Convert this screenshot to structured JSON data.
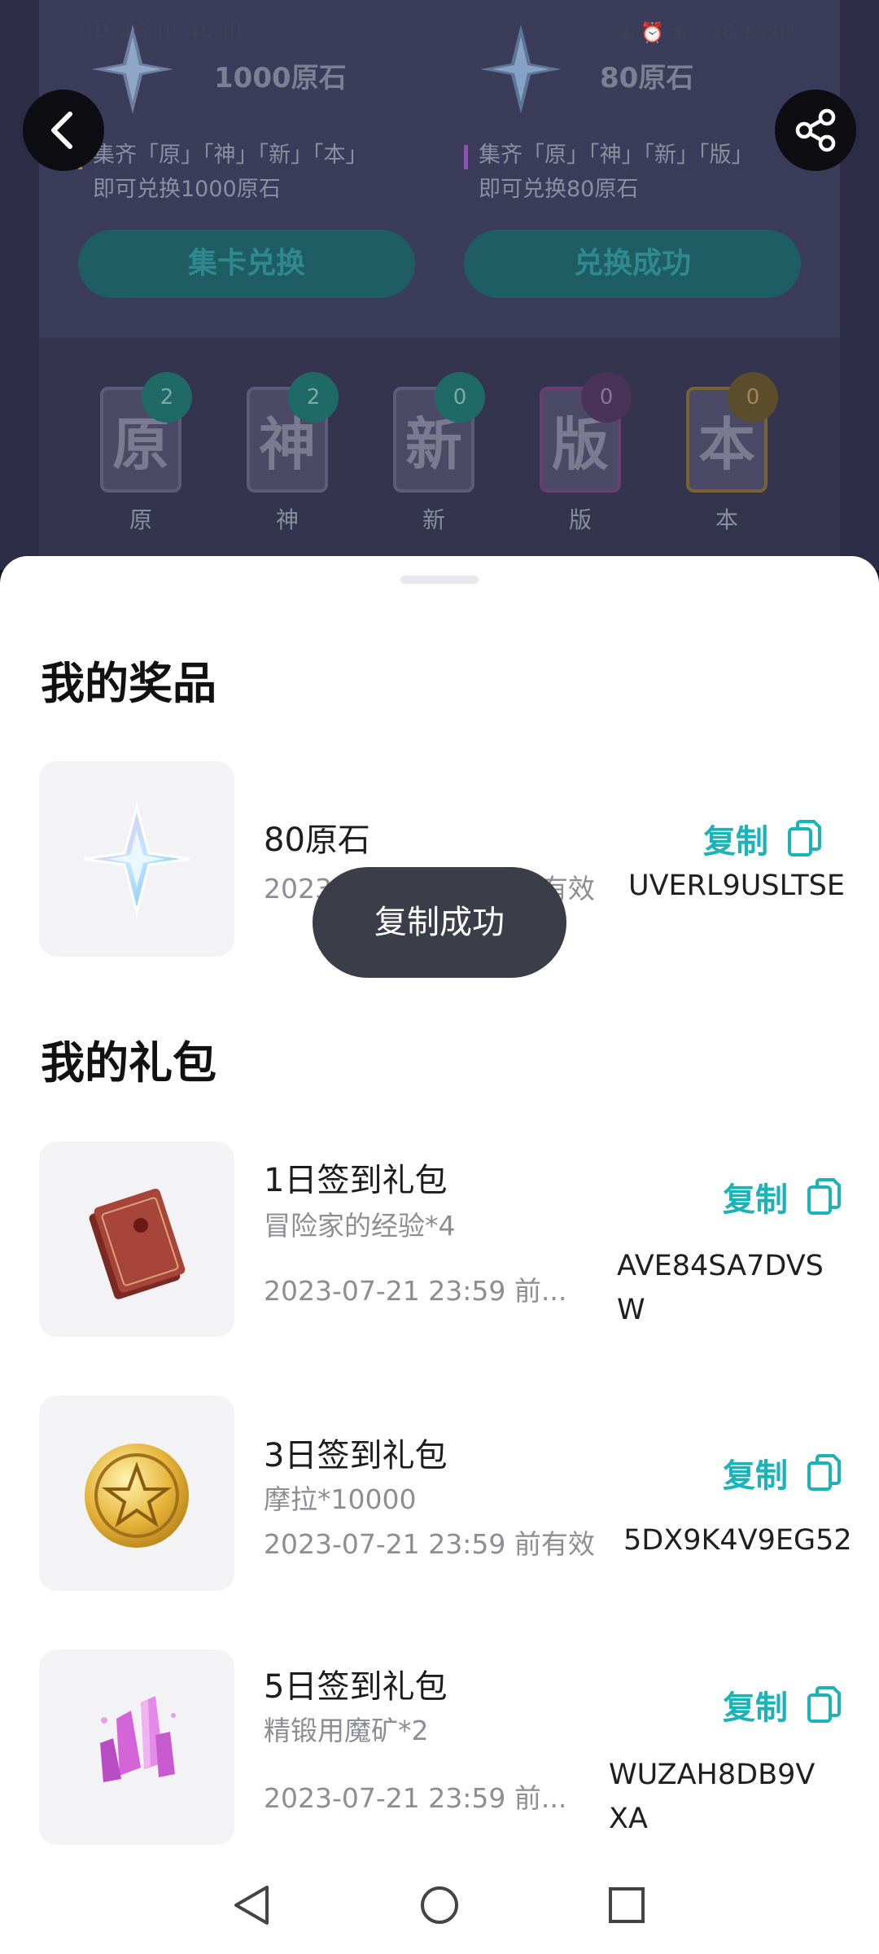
{
  "status_bar": {
    "left": "HD 4G ıll 46 ıll",
    "right": "◉ ⏰ ✱ ▯ 76 16:01"
  },
  "rewards": [
    {
      "amount": "1000原石",
      "desc": "集齐「原」「神」「新」「本」即可兑换1000原石",
      "button": "集卡兑换"
    },
    {
      "amount": "80原石",
      "desc": "集齐「原」「神」「新」「版」即可兑换80原石",
      "button": "兑换成功"
    }
  ],
  "cards": [
    {
      "char": "原",
      "count": "2",
      "label": "原"
    },
    {
      "char": "神",
      "count": "2",
      "label": "神"
    },
    {
      "char": "新",
      "count": "0",
      "label": "新"
    },
    {
      "char": "版",
      "count": "0",
      "label": "版"
    },
    {
      "char": "本",
      "count": "0",
      "label": "本"
    }
  ],
  "sheet": {
    "prizes_title": "我的奖品",
    "prizes": [
      {
        "title": "80原石",
        "date": "2023-07-21 23:59 前有效",
        "copy_label": "复制",
        "code": "UVERL9USLTSE",
        "icon": "primogem-icon"
      }
    ],
    "gifts_title": "我的礼包",
    "gifts": [
      {
        "title": "1日签到礼包",
        "subtitle": "冒险家的经验*4",
        "date": "2023-07-21 23:59 前...",
        "copy_label": "复制",
        "code": "AVE84SA7DVSW",
        "icon": "exp-book-icon"
      },
      {
        "title": "3日签到礼包",
        "subtitle": "摩拉*10000",
        "date": "2023-07-21 23:59 前有效",
        "copy_label": "复制",
        "code": "5DX9K4V9EG52",
        "icon": "mora-coin-icon"
      },
      {
        "title": "5日签到礼包",
        "subtitle": "精锻用魔矿*2",
        "date": "2023-07-21 23:59 前...",
        "copy_label": "复制",
        "code": "WUZAH8DB9VXA",
        "icon": "crystal-ore-icon"
      }
    ]
  },
  "toast": "复制成功",
  "colors": {
    "accent": "#1ab4b8",
    "toast_bg": "#3b3e48"
  }
}
